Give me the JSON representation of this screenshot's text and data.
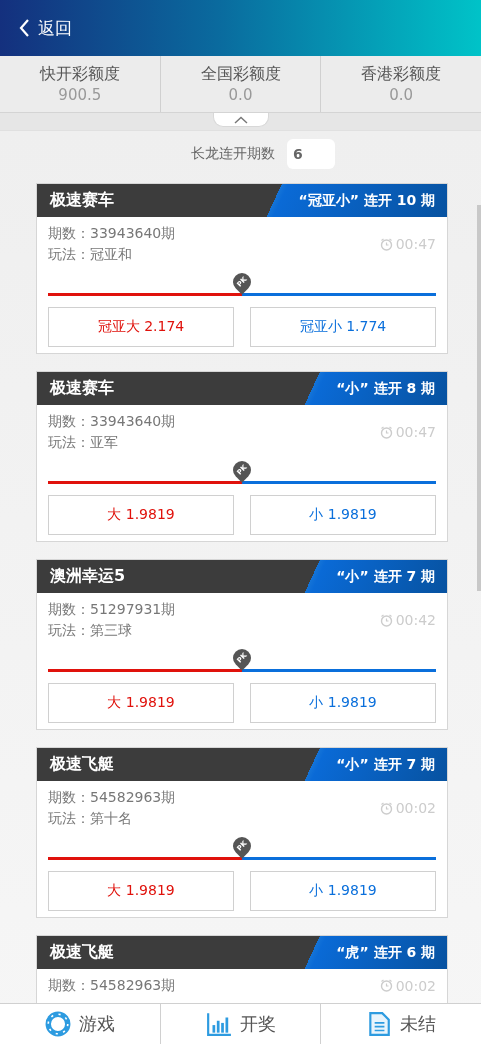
{
  "header": {
    "back_label": "返回"
  },
  "quotas": [
    {
      "label": "快开彩额度",
      "value": "900.5"
    },
    {
      "label": "全国彩额度",
      "value": "0.0"
    },
    {
      "label": "香港彩额度",
      "value": "0.0"
    }
  ],
  "streak_filter": {
    "label": "长龙连开期数",
    "value": "6"
  },
  "cards": [
    {
      "title": "极速赛车",
      "streak": "“冠亚小” 连开 10 期",
      "period": "期数：33943640期",
      "play": "玩法：冠亚和",
      "time": "00:47",
      "level": 0.5,
      "pk_label": "PK",
      "options": [
        {
          "label": "冠亚大 2.174",
          "color": "#e0120c"
        },
        {
          "label": "冠亚小 1.774",
          "color": "#0a6fdb"
        }
      ]
    },
    {
      "title": "极速赛车",
      "streak": "“小” 连开 8 期",
      "period": "期数：33943640期",
      "play": "玩法：亚军",
      "time": "00:47",
      "level": 0.5,
      "pk_label": "PK",
      "options": [
        {
          "label": "大 1.9819",
          "color": "#e0120c"
        },
        {
          "label": "小 1.9819",
          "color": "#0a6fdb"
        }
      ]
    },
    {
      "title": "澳洲幸运5",
      "streak": "“小” 连开 7 期",
      "period": "期数：51297931期",
      "play": "玩法：第三球",
      "time": "00:42",
      "level": 0.5,
      "pk_label": "PK",
      "options": [
        {
          "label": "大 1.9819",
          "color": "#e0120c"
        },
        {
          "label": "小 1.9819",
          "color": "#0a6fdb"
        }
      ]
    },
    {
      "title": "极速飞艇",
      "streak": "“小” 连开 7 期",
      "period": "期数：54582963期",
      "play": "玩法：第十名",
      "time": "00:02",
      "level": 0.5,
      "pk_label": "PK",
      "options": [
        {
          "label": "大 1.9819",
          "color": "#e0120c"
        },
        {
          "label": "小 1.9819",
          "color": "#0a6fdb"
        }
      ]
    },
    {
      "title": "极速飞艇",
      "streak": "“虎” 连开 6 期",
      "period": "期数：54582963期",
      "time": "00:02"
    }
  ],
  "tabbar": [
    {
      "label": "游戏"
    },
    {
      "label": "开奖"
    },
    {
      "label": "未结"
    }
  ]
}
